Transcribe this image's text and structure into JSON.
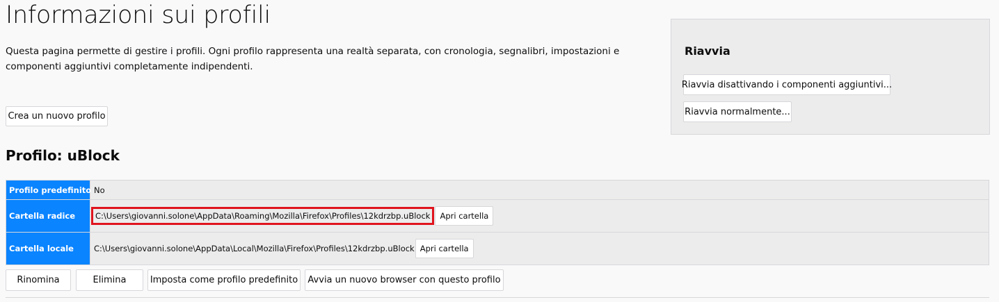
{
  "page": {
    "title": "Informazioni sui profili",
    "intro": "Questa pagina permette di gestire i profili. Ogni profilo rappresenta una realtà separata, con cronologia, segnalibri, impostazioni e componenti aggiuntivi completamente indipendenti.",
    "create_button": "Crea un nuovo profilo"
  },
  "restart": {
    "title": "Riavvia",
    "safe_mode_button": "Riavvia disattivando i componenti aggiuntivi...",
    "normal_button": "Riavvia normalmente..."
  },
  "profile": {
    "title": "Profilo: uBlock",
    "rows": [
      {
        "label": "Profilo predefinito",
        "value": "No"
      },
      {
        "label": "Cartella radice",
        "value": "C:\\Users\\giovanni.solone\\AppData\\Roaming\\Mozilla\\Firefox\\Profiles\\12kdrzbp.uBlock",
        "button": "Apri cartella",
        "highlighted": true
      },
      {
        "label": "Cartella locale",
        "value": "C:\\Users\\giovanni.solone\\AppData\\Local\\Mozilla\\Firefox\\Profiles\\12kdrzbp.uBlock",
        "button": "Apri cartella"
      }
    ],
    "actions": {
      "rename": "Rinomina",
      "delete": "Elimina",
      "set_default": "Imposta come profilo predefinito",
      "launch": "Avvia un nuovo browser con questo profilo"
    }
  },
  "colors": {
    "header_cell": "#0a84ff",
    "highlight_box": "#e0141e",
    "restart_panel": "#ececec"
  }
}
